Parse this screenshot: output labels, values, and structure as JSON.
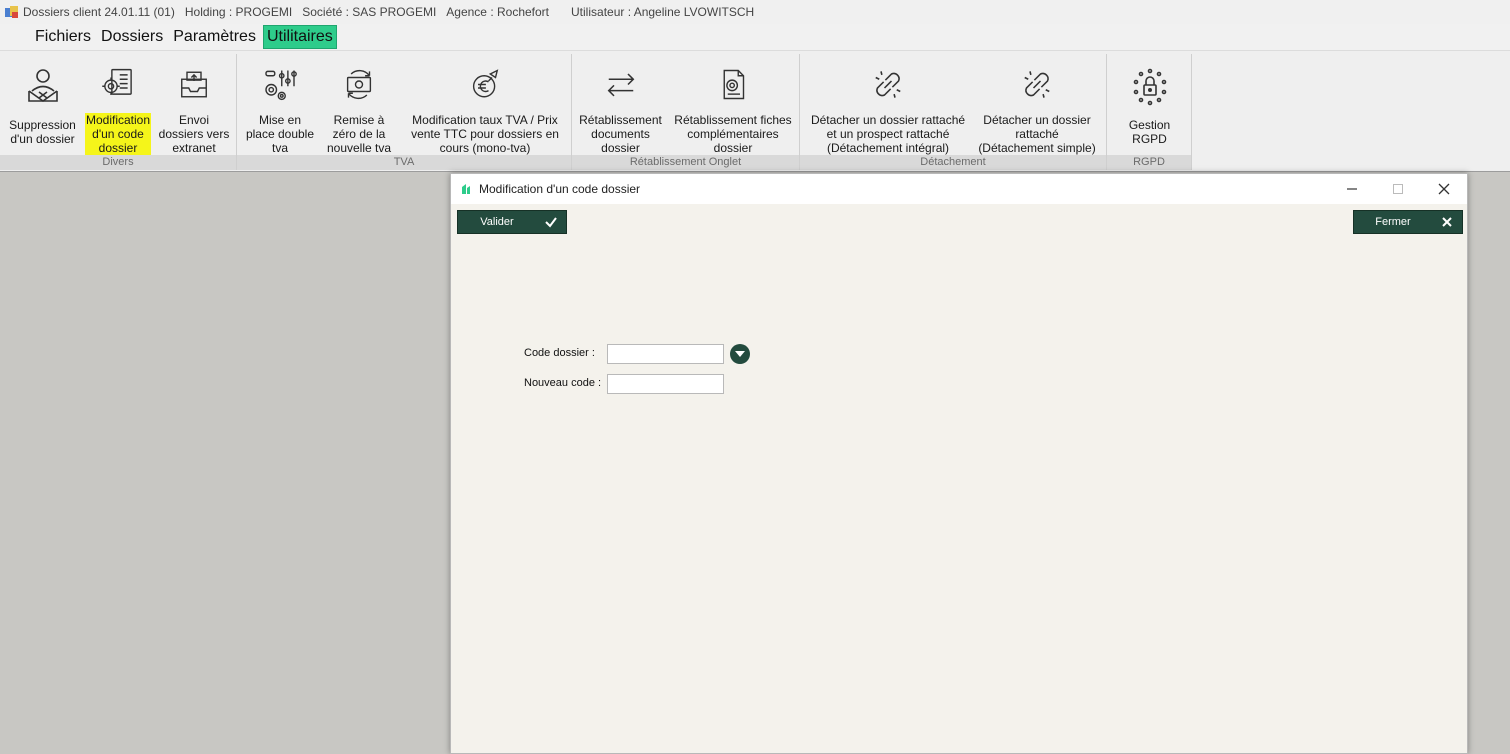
{
  "titlebar": {
    "app": "Dossiers client 24.01.11 (01)",
    "holding": "Holding : PROGEMI",
    "societe": "Société : SAS PROGEMI",
    "agence": "Agence : Rochefort",
    "utilisateur": "Utilisateur : Angeline LVOWITSCH"
  },
  "menu": {
    "items": [
      "Fichiers",
      "Dossiers",
      "Paramètres",
      "Utilitaires"
    ],
    "active": "Utilitaires",
    "active_color": "#2ecc8b"
  },
  "ribbon": {
    "groups": [
      {
        "label": "Divers",
        "buttons": [
          {
            "label": "Suppression\nd'un dossier",
            "icon": "person-delete-icon"
          },
          {
            "label": "Modification\nd'un code\ndossier",
            "icon": "settings-document-icon",
            "highlighted": true
          },
          {
            "label": "Envoi\ndossiers vers\nextranet",
            "icon": "inbox-upload-icon"
          }
        ]
      },
      {
        "label": "TVA",
        "buttons": [
          {
            "label": "Mise en\nplace double\ntva",
            "icon": "sliders-gears-icon"
          },
          {
            "label": "Remise à\nzéro de la\nnouvelle tva",
            "icon": "money-reset-icon"
          },
          {
            "label": "Modification taux TVA  / Prix\nvente TTC pour dossiers en\ncours (mono-tva)",
            "icon": "euro-rocket-icon"
          }
        ]
      },
      {
        "label": "Rétablissement Onglet",
        "buttons": [
          {
            "label": "Rétablissement\ndocuments\ndossier",
            "icon": "swap-arrows-icon"
          },
          {
            "label": "Rétablissement fiches\ncomplémentaires\ndossier",
            "icon": "document-settings-icon"
          }
        ]
      },
      {
        "label": "Détachement",
        "buttons": [
          {
            "label": "Détacher un dossier rattaché\net un prospect rattaché\n(Détachement intégral)",
            "icon": "broken-link-icon"
          },
          {
            "label": "Détacher un dossier\nrattaché\n(Détachement simple)",
            "icon": "broken-link-icon"
          }
        ]
      },
      {
        "label": "RGPD",
        "buttons": [
          {
            "label": "Gestion\nRGPD",
            "icon": "lock-stars-icon"
          }
        ]
      }
    ],
    "highlight_color": "#f5f51a"
  },
  "dialog": {
    "title": "Modification d'un code dossier",
    "valider": "Valider",
    "fermer": "Fermer",
    "button_color": "#234b3e",
    "code_label": "Code dossier :",
    "code_value": "",
    "nouveau_label": "Nouveau code :",
    "nouveau_value": ""
  }
}
